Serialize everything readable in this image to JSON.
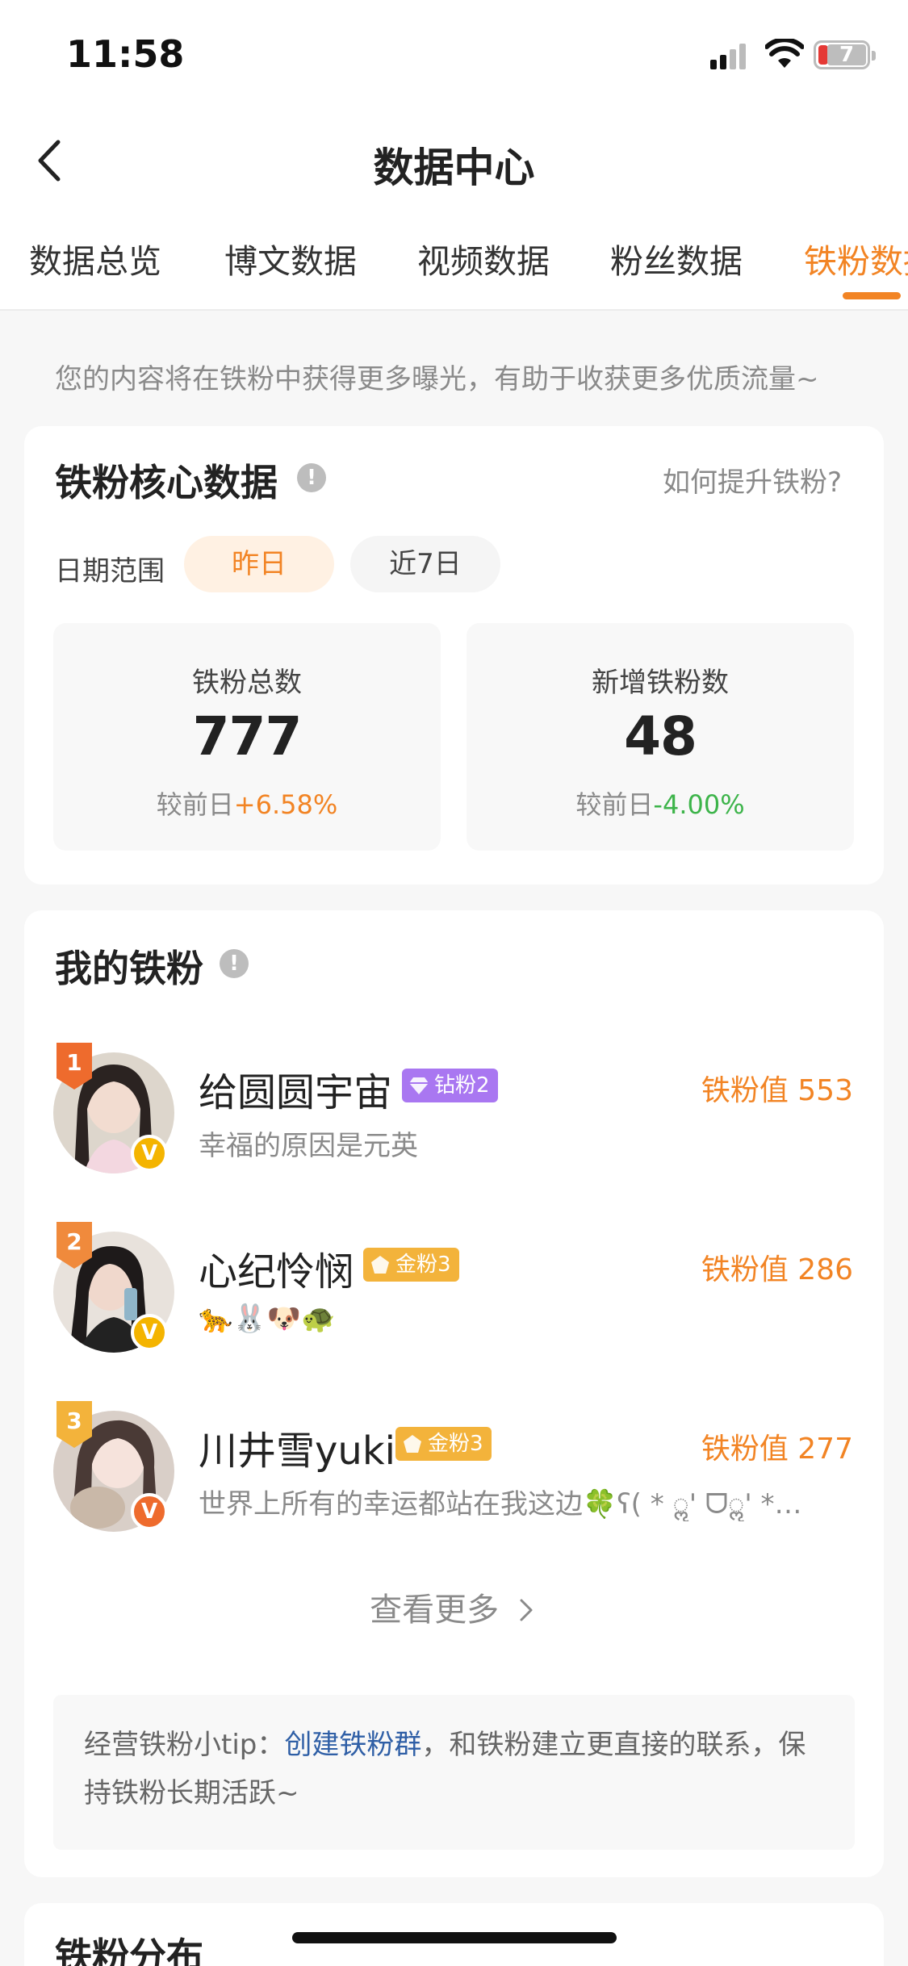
{
  "status_bar": {
    "time": "11:58",
    "battery": "7"
  },
  "nav": {
    "title": "数据中心"
  },
  "tabs": [
    {
      "label": "数据总览"
    },
    {
      "label": "博文数据"
    },
    {
      "label": "视频数据"
    },
    {
      "label": "粉丝数据"
    },
    {
      "label": "铁粉数据"
    }
  ],
  "hint": "您的内容将在铁粉中获得更多曝光，有助于收获更多优质流量~",
  "core": {
    "title": "铁粉核心数据",
    "info": "!",
    "howto": "如何提升铁粉?",
    "date_label": "日期范围",
    "chip_yesterday": "昨日",
    "chip_7d": "近7日",
    "stats": [
      {
        "label": "铁粉总数",
        "value": "777",
        "cmp_prefix": "较前日",
        "cmp_value": "+6.58%"
      },
      {
        "label": "新增铁粉数",
        "value": "48",
        "cmp_prefix": "较前日",
        "cmp_value": "-4.00%"
      }
    ]
  },
  "my_fans": {
    "title": "我的铁粉",
    "info": "!",
    "fans": [
      {
        "rank": "1",
        "name": "给圆圆宇宙",
        "badge": "钻粉2",
        "value_label": "铁粉值 553",
        "signature": "幸福的原因是元英",
        "v": "V"
      },
      {
        "rank": "2",
        "name": "心纪怜悯",
        "badge": "金粉3",
        "value_label": "铁粉值 286",
        "signature": "🐆🐰🐶🐢",
        "v": "V"
      },
      {
        "rank": "3",
        "name": "川井雪yuki",
        "badge": "金粉3",
        "value_label": "铁粉值 277",
        "signature": "世界上所有的幸运都站在我这边🍀ʕ( * ॢ' ᗜॢ' *…",
        "v": "V"
      }
    ],
    "more": "查看更多",
    "tip_prefix": "经营铁粉小tip：",
    "tip_link": "创建铁粉群",
    "tip_suffix": "，和铁粉建立更直接的联系，保持铁粉长期活跃~"
  },
  "distribution": {
    "title": "铁粉分布"
  },
  "colors": {
    "accent": "#f28424",
    "positive": "#f28424",
    "negative": "#3db44a",
    "link": "#2f5fa6"
  }
}
